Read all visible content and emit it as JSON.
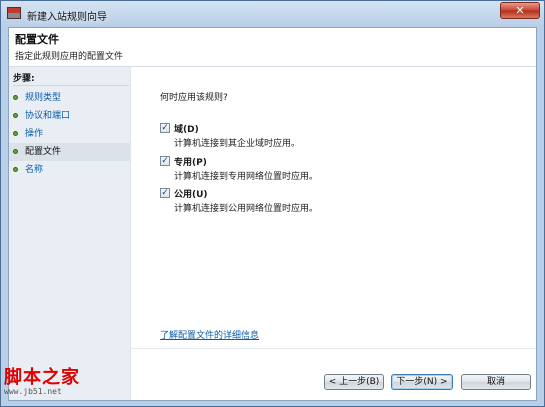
{
  "window": {
    "title": "新建入站规则向导",
    "close_label": "✕"
  },
  "header": {
    "title": "配置文件",
    "subtitle": "指定此规则应用的配置文件"
  },
  "steps": {
    "heading": "步骤:",
    "items": [
      {
        "label": "规则类型"
      },
      {
        "label": "协议和端口"
      },
      {
        "label": "操作"
      },
      {
        "label": "配置文件",
        "active": true
      },
      {
        "label": "名称"
      }
    ]
  },
  "main": {
    "question": "何时应用该规则?",
    "options": [
      {
        "name": "域(D)",
        "desc": "计算机连接到其企业域时应用。",
        "checked": true
      },
      {
        "name": "专用(P)",
        "desc": "计算机连接到专用网络位置时应用。",
        "checked": true
      },
      {
        "name": "公用(U)",
        "desc": "计算机连接到公用网络位置时应用。",
        "checked": true
      }
    ],
    "learn_more": "了解配置文件的详细信息"
  },
  "buttons": {
    "back": "< 上一步(B)",
    "next": "下一步(N) >",
    "cancel": "取消"
  },
  "watermark": {
    "text": "脚本之家",
    "url": "www.jb51.net"
  },
  "icons": {
    "app": "firewall-icon",
    "check": "checkmark-icon",
    "step": "green-bullet-icon"
  }
}
